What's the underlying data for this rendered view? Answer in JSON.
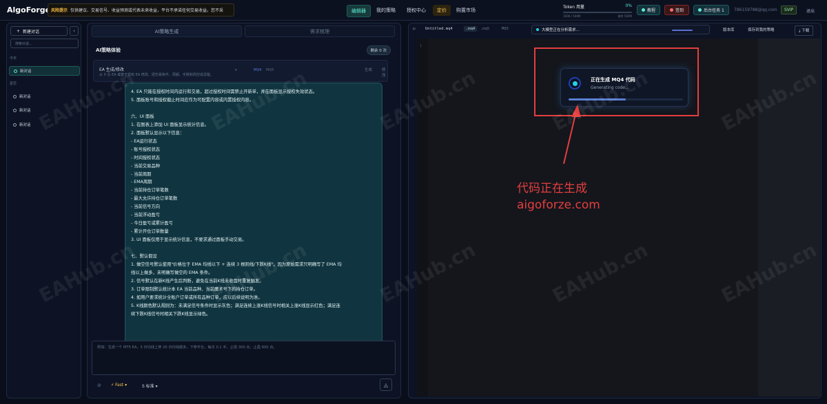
{
  "app": {
    "logo": "AlgoForge"
  },
  "risk": {
    "tag": "风险提示",
    "text": "仅供建议、交易信号、收益预测或代表未来收益，平台不承诺任何交易收益。您不采"
  },
  "nav": [
    "编辑器",
    "我的策略",
    "授权中心",
    "定价",
    "购置市场"
  ],
  "token": {
    "label": "Token 用量",
    "percent": "0%",
    "used": "160K / 500M",
    "remaining": "剩余 500M"
  },
  "pills": {
    "tutorial": "教程",
    "sign": "签到",
    "tasks": "后台任务 1"
  },
  "user": {
    "email": "786159788@qq.com",
    "tier": "SVIP",
    "logout": "退出"
  },
  "sidebar": {
    "new_chat": "新建对话",
    "collapse": "‹",
    "search_placeholder": "搜索对话...",
    "today": "今天",
    "earlier": "更早",
    "active_chat": "新对话",
    "chats": [
      "新对话",
      "新对话",
      "新对话"
    ]
  },
  "middle": {
    "tabs": [
      "AI策略生成",
      "需求梳理"
    ],
    "panel_title": "AI策略体验",
    "remaining": "剩余 0 次",
    "ea_title": "EA 生成/修改",
    "ea_sub": "从 0 写 EA 或基于现有 EA 修改、把交易条件、周期、手数和风控说清楚。",
    "chips": [
      "MQ4",
      "MQ5"
    ],
    "buttons": [
      "生成",
      "修改"
    ],
    "lines": [
      "4. EA 只能在授权时间内运行和交易，超过授权时间需禁止开新单，并在面板显示授权失效状态。",
      "5. 面板账号和授权截止时间应作为可配置内容或内置授权内容。",
      "",
      "六、UI 面板",
      "1. 在图表上添加 UI 面板显示统计信息。",
      "2. 面板默认显示以下信息：",
      "   - EA运行状态",
      "   - 账号授权状态",
      "   - 时间授权状态",
      "   - 当前交易品种",
      "   - 当前周期",
      "   - EMA周期",
      "   - 当前持仓订单笔数",
      "   - 最大允许持仓订单笔数",
      "   - 当前信号方向",
      "   - 当前浮动盈亏",
      "   - 今日盈亏或累计盈亏",
      "   - 累计开仓订单数量",
      "3. UI 面板仅用于显示统计信息，不要求通过面板手动交易。",
      "",
      "七、默认假设",
      "1. 做空信号默认使用\"价格位于 EMA 均线以下 + 连续 3 根阴线/下跌K线\"，因为原始需求只明确写了 EMA 均",
      "线以上做多，未明确写做空的 EMA 条件。",
      "2. 信号默认在新K线产生后判断，避免在当前K线未收盘时重复触发。",
      "3. 订单限制默认统计本 EA 当前品种、当前魔术号下的持仓订单。",
      "4. 如用户要求统计全账户订单或所有品种订单，应以后续说明为准。",
      "5. K线颜色默认规则为：未满足信号条件时显示灰色；满足连续上涨K线信号时相关上涨K线显示红色；满足连",
      "续下跌K线信号时相关下跌K线显示绿色。"
    ],
    "input_placeholder": "例如：生成一个 MT5 EA，5 日均线上穿 20 日均线做多，下穿平仓，每次 0.1 手，止损 300 点，止盈 600 点。",
    "attach": "⊘",
    "model": "Fast",
    "mode": "S 标准"
  },
  "right": {
    "file": "Untitled.mq4",
    "ext1": ".mq4",
    "ext2": ".mq5",
    "ext3": "MQ5",
    "status": "大模型正在分析需求...",
    "version": "版本库",
    "save": "保存到我的策略",
    "download": "下载",
    "line_no": "1",
    "gen_title": "正在生成 MQ4 代码",
    "gen_sub": "Generating code...",
    "gen_progress": 0.5
  },
  "annotation": {
    "line1": "代码正在生成",
    "line2": "aigoforze.com"
  },
  "watermark": "EAHub.cn"
}
